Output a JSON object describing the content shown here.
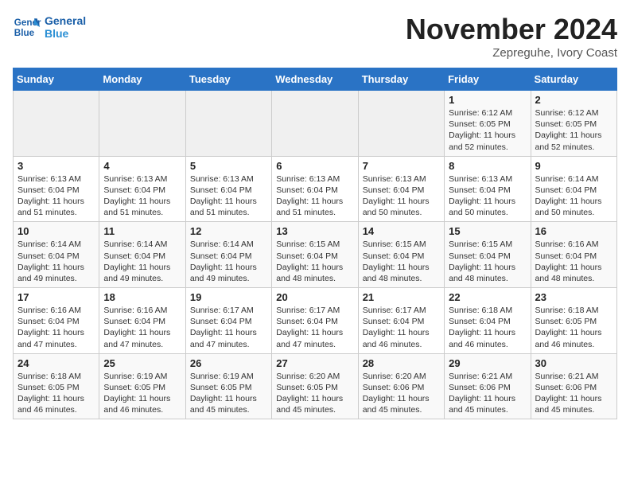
{
  "header": {
    "logo_line1": "General",
    "logo_line2": "Blue",
    "month": "November 2024",
    "location": "Zepreguhe, Ivory Coast"
  },
  "weekdays": [
    "Sunday",
    "Monday",
    "Tuesday",
    "Wednesday",
    "Thursday",
    "Friday",
    "Saturday"
  ],
  "weeks": [
    {
      "days": [
        {
          "date": "",
          "info": ""
        },
        {
          "date": "",
          "info": ""
        },
        {
          "date": "",
          "info": ""
        },
        {
          "date": "",
          "info": ""
        },
        {
          "date": "",
          "info": ""
        },
        {
          "date": "1",
          "info": "Sunrise: 6:12 AM\nSunset: 6:05 PM\nDaylight: 11 hours\nand 52 minutes."
        },
        {
          "date": "2",
          "info": "Sunrise: 6:12 AM\nSunset: 6:05 PM\nDaylight: 11 hours\nand 52 minutes."
        }
      ]
    },
    {
      "days": [
        {
          "date": "3",
          "info": "Sunrise: 6:13 AM\nSunset: 6:04 PM\nDaylight: 11 hours\nand 51 minutes."
        },
        {
          "date": "4",
          "info": "Sunrise: 6:13 AM\nSunset: 6:04 PM\nDaylight: 11 hours\nand 51 minutes."
        },
        {
          "date": "5",
          "info": "Sunrise: 6:13 AM\nSunset: 6:04 PM\nDaylight: 11 hours\nand 51 minutes."
        },
        {
          "date": "6",
          "info": "Sunrise: 6:13 AM\nSunset: 6:04 PM\nDaylight: 11 hours\nand 51 minutes."
        },
        {
          "date": "7",
          "info": "Sunrise: 6:13 AM\nSunset: 6:04 PM\nDaylight: 11 hours\nand 50 minutes."
        },
        {
          "date": "8",
          "info": "Sunrise: 6:13 AM\nSunset: 6:04 PM\nDaylight: 11 hours\nand 50 minutes."
        },
        {
          "date": "9",
          "info": "Sunrise: 6:14 AM\nSunset: 6:04 PM\nDaylight: 11 hours\nand 50 minutes."
        }
      ]
    },
    {
      "days": [
        {
          "date": "10",
          "info": "Sunrise: 6:14 AM\nSunset: 6:04 PM\nDaylight: 11 hours\nand 49 minutes."
        },
        {
          "date": "11",
          "info": "Sunrise: 6:14 AM\nSunset: 6:04 PM\nDaylight: 11 hours\nand 49 minutes."
        },
        {
          "date": "12",
          "info": "Sunrise: 6:14 AM\nSunset: 6:04 PM\nDaylight: 11 hours\nand 49 minutes."
        },
        {
          "date": "13",
          "info": "Sunrise: 6:15 AM\nSunset: 6:04 PM\nDaylight: 11 hours\nand 48 minutes."
        },
        {
          "date": "14",
          "info": "Sunrise: 6:15 AM\nSunset: 6:04 PM\nDaylight: 11 hours\nand 48 minutes."
        },
        {
          "date": "15",
          "info": "Sunrise: 6:15 AM\nSunset: 6:04 PM\nDaylight: 11 hours\nand 48 minutes."
        },
        {
          "date": "16",
          "info": "Sunrise: 6:16 AM\nSunset: 6:04 PM\nDaylight: 11 hours\nand 48 minutes."
        }
      ]
    },
    {
      "days": [
        {
          "date": "17",
          "info": "Sunrise: 6:16 AM\nSunset: 6:04 PM\nDaylight: 11 hours\nand 47 minutes."
        },
        {
          "date": "18",
          "info": "Sunrise: 6:16 AM\nSunset: 6:04 PM\nDaylight: 11 hours\nand 47 minutes."
        },
        {
          "date": "19",
          "info": "Sunrise: 6:17 AM\nSunset: 6:04 PM\nDaylight: 11 hours\nand 47 minutes."
        },
        {
          "date": "20",
          "info": "Sunrise: 6:17 AM\nSunset: 6:04 PM\nDaylight: 11 hours\nand 47 minutes."
        },
        {
          "date": "21",
          "info": "Sunrise: 6:17 AM\nSunset: 6:04 PM\nDaylight: 11 hours\nand 46 minutes."
        },
        {
          "date": "22",
          "info": "Sunrise: 6:18 AM\nSunset: 6:04 PM\nDaylight: 11 hours\nand 46 minutes."
        },
        {
          "date": "23",
          "info": "Sunrise: 6:18 AM\nSunset: 6:05 PM\nDaylight: 11 hours\nand 46 minutes."
        }
      ]
    },
    {
      "days": [
        {
          "date": "24",
          "info": "Sunrise: 6:18 AM\nSunset: 6:05 PM\nDaylight: 11 hours\nand 46 minutes."
        },
        {
          "date": "25",
          "info": "Sunrise: 6:19 AM\nSunset: 6:05 PM\nDaylight: 11 hours\nand 46 minutes."
        },
        {
          "date": "26",
          "info": "Sunrise: 6:19 AM\nSunset: 6:05 PM\nDaylight: 11 hours\nand 45 minutes."
        },
        {
          "date": "27",
          "info": "Sunrise: 6:20 AM\nSunset: 6:05 PM\nDaylight: 11 hours\nand 45 minutes."
        },
        {
          "date": "28",
          "info": "Sunrise: 6:20 AM\nSunset: 6:06 PM\nDaylight: 11 hours\nand 45 minutes."
        },
        {
          "date": "29",
          "info": "Sunrise: 6:21 AM\nSunset: 6:06 PM\nDaylight: 11 hours\nand 45 minutes."
        },
        {
          "date": "30",
          "info": "Sunrise: 6:21 AM\nSunset: 6:06 PM\nDaylight: 11 hours\nand 45 minutes."
        }
      ]
    }
  ]
}
